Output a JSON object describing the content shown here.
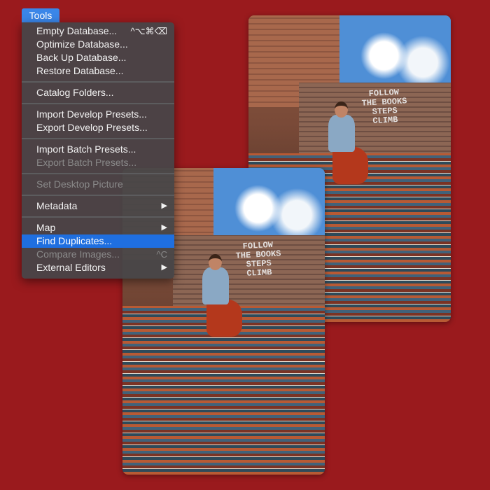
{
  "menu_bar": {
    "title": "Tools"
  },
  "menu": {
    "groups": [
      [
        {
          "label": "Empty Database...",
          "shortcut": "^⌥⌘⌫",
          "enabled": true
        },
        {
          "label": "Optimize Database...",
          "enabled": true
        },
        {
          "label": "Back Up Database...",
          "enabled": true
        },
        {
          "label": "Restore Database...",
          "enabled": true
        }
      ],
      [
        {
          "label": "Catalog Folders...",
          "enabled": true
        }
      ],
      [
        {
          "label": "Import Develop Presets...",
          "enabled": true
        },
        {
          "label": "Export Develop Presets...",
          "enabled": true
        }
      ],
      [
        {
          "label": "Import Batch Presets...",
          "enabled": true
        },
        {
          "label": "Export Batch Presets...",
          "enabled": false
        }
      ],
      [
        {
          "label": "Set Desktop Picture",
          "enabled": false
        }
      ],
      [
        {
          "label": "Metadata",
          "submenu": "▶",
          "enabled": true
        }
      ],
      [
        {
          "label": "Map",
          "submenu": "▶",
          "enabled": true
        },
        {
          "label": "Find Duplicates...",
          "enabled": true,
          "highlighted": true
        },
        {
          "label": "Compare Images...",
          "shortcut": "^C",
          "enabled": false
        },
        {
          "label": "External Editors",
          "submenu": "▶",
          "enabled": true
        }
      ]
    ]
  },
  "photos": {
    "graffiti": "FOLLOW\nTHE BOOKS\nSTEPS\nCLIMB"
  },
  "colors": {
    "background": "#9a1a1d",
    "highlight": "#1f6fe0"
  }
}
